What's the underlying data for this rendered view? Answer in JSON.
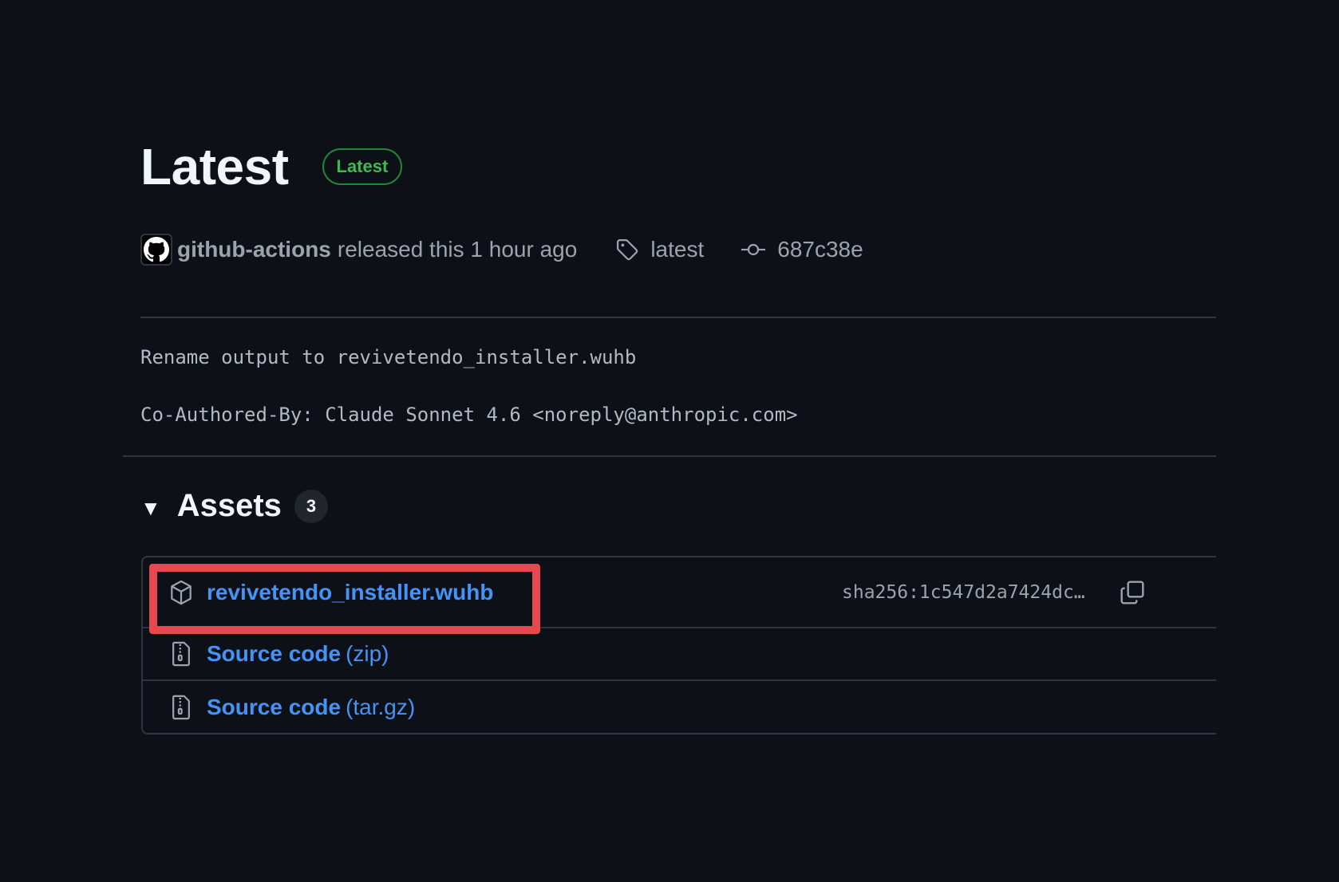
{
  "release": {
    "title": "Latest",
    "badge": "Latest"
  },
  "meta": {
    "author": "github-actions",
    "released_text": "released this 1 hour ago",
    "tag": "latest",
    "commit": "687c38e",
    "icons": {
      "avatar": "github-octocat-icon",
      "tag": "tag-icon",
      "commit": "git-commit-icon"
    }
  },
  "commit_message": {
    "line1": "Rename output to revivetendo_installer.wuhb",
    "line2": "Co-Authored-By: Claude Sonnet 4.6 <noreply@anthropic.com>"
  },
  "assets": {
    "title": "Assets",
    "count": "3",
    "caret": "▼",
    "items": [
      {
        "name": "revivetendo_installer.wuhb",
        "suffix": "",
        "sha": "sha256:1c547d2a7424dc…",
        "icon": "package-icon",
        "highlighted": true
      },
      {
        "name": "Source code",
        "suffix": "(zip)",
        "icon": "file-zip-icon"
      },
      {
        "name": "Source code",
        "suffix": "(tar.gz)",
        "icon": "file-zip-icon"
      }
    ]
  },
  "colors": {
    "background": "#0d1117",
    "link": "#4493f8",
    "badge_green": "#3fb950",
    "highlight_red": "#e5484d",
    "border": "#30363d"
  }
}
